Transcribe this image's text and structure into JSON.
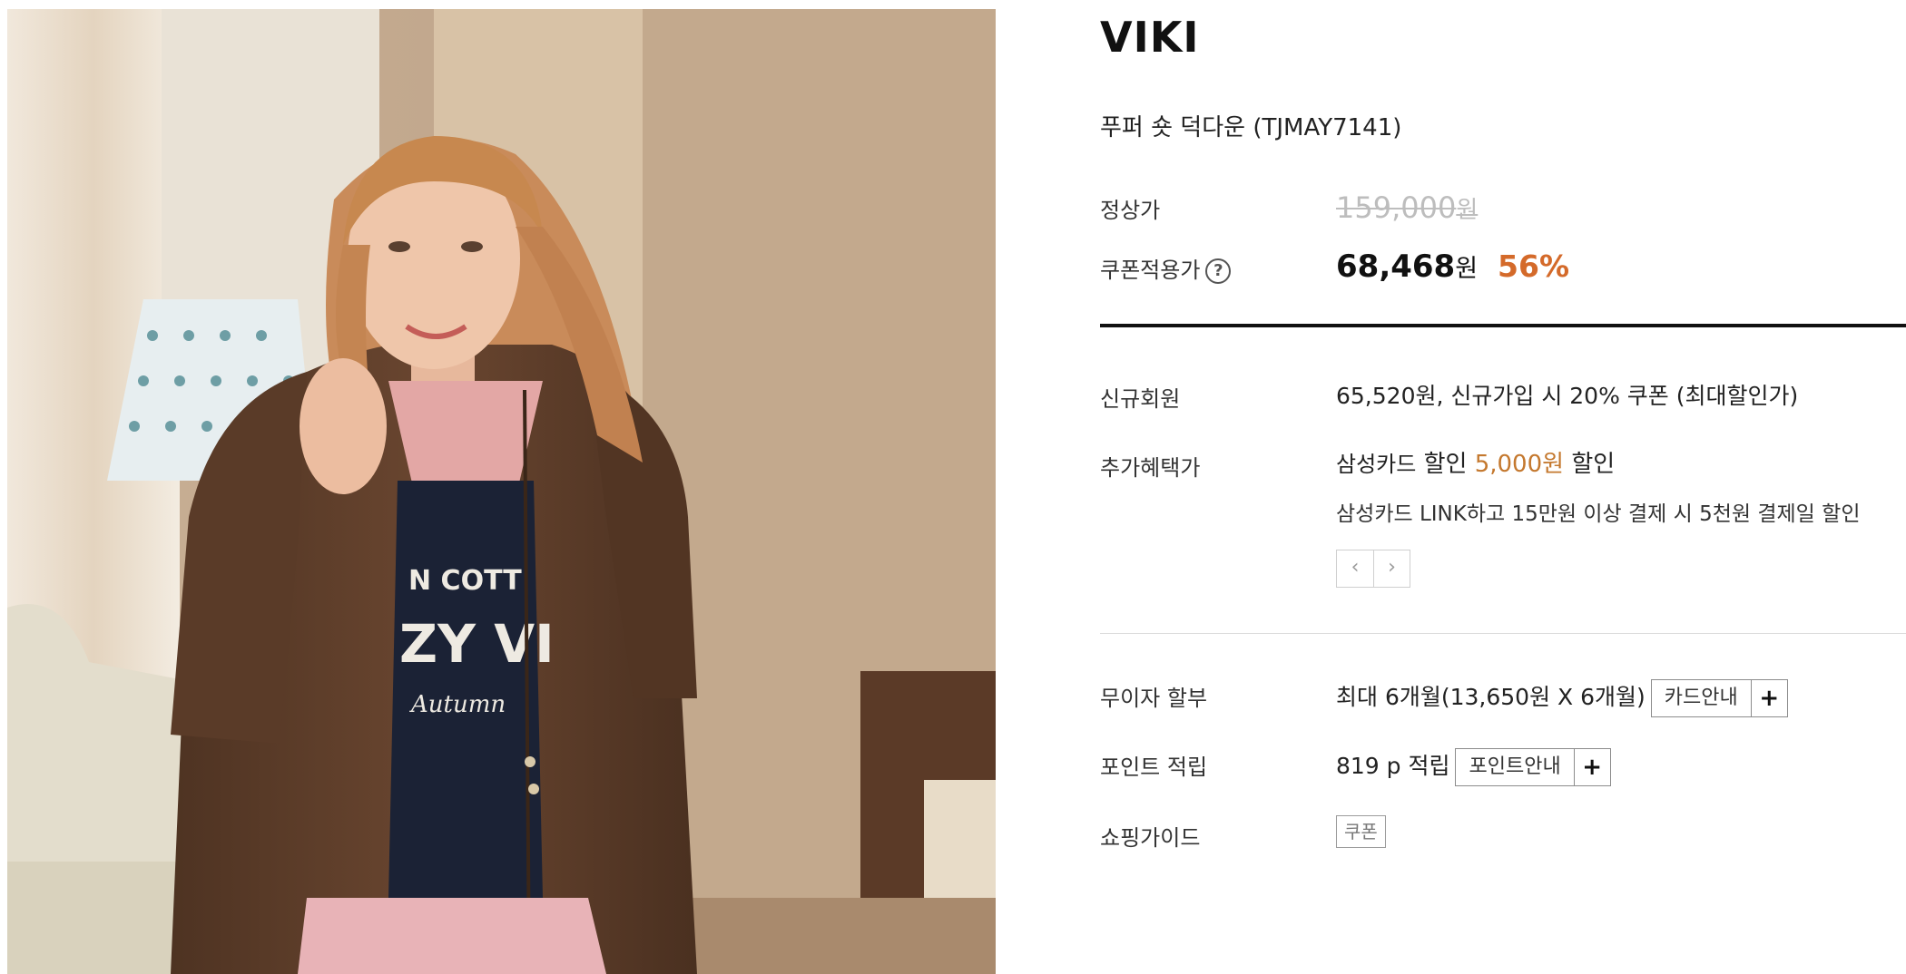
{
  "photo": {
    "alt_icon": "product-photo-model-in-brown-puffer-jacket",
    "print_line1": "N COTT",
    "print_line2": "ZY VI",
    "print_line3": "Autumn"
  },
  "brand": "VIKI",
  "product_name": "푸퍼 숏 덕다운 (TJMAY7141)",
  "regular_price": {
    "label": "정상가",
    "amount": "159,000",
    "unit": "원"
  },
  "coupon_price": {
    "label": "쿠폰적용가",
    "help_icon": "?",
    "amount": "68,468",
    "unit": "원",
    "discount_rate": "56%"
  },
  "new_member": {
    "label": "신규회원",
    "text": "65,520원, 신규가입 시 20% 쿠폰 (최대할인가)"
  },
  "extra_benefit": {
    "label": "추가혜택가",
    "card": "삼성카드",
    "discount_word": "할인",
    "amount": "5,000원",
    "suffix": "할인",
    "description": "삼성카드 LINK하고 15만원 이상 결제 시 5천원 결제일 할인",
    "prev_icon": "‹",
    "next_icon": "›"
  },
  "installment": {
    "label": "무이자 할부",
    "text": "최대 6개월(13,650원 X 6개월)",
    "button": "카드안내",
    "plus": "+"
  },
  "points": {
    "label": "포인트 적립",
    "text": "819 p 적립",
    "button": "포인트안내",
    "plus": "+"
  },
  "shopping_guide": {
    "label": "쇼핑가이드",
    "tag": "쿠폰"
  },
  "colors": {
    "accent": "#d46a2a",
    "strikethrough": "#bdbdbd",
    "divider": "#111111"
  }
}
